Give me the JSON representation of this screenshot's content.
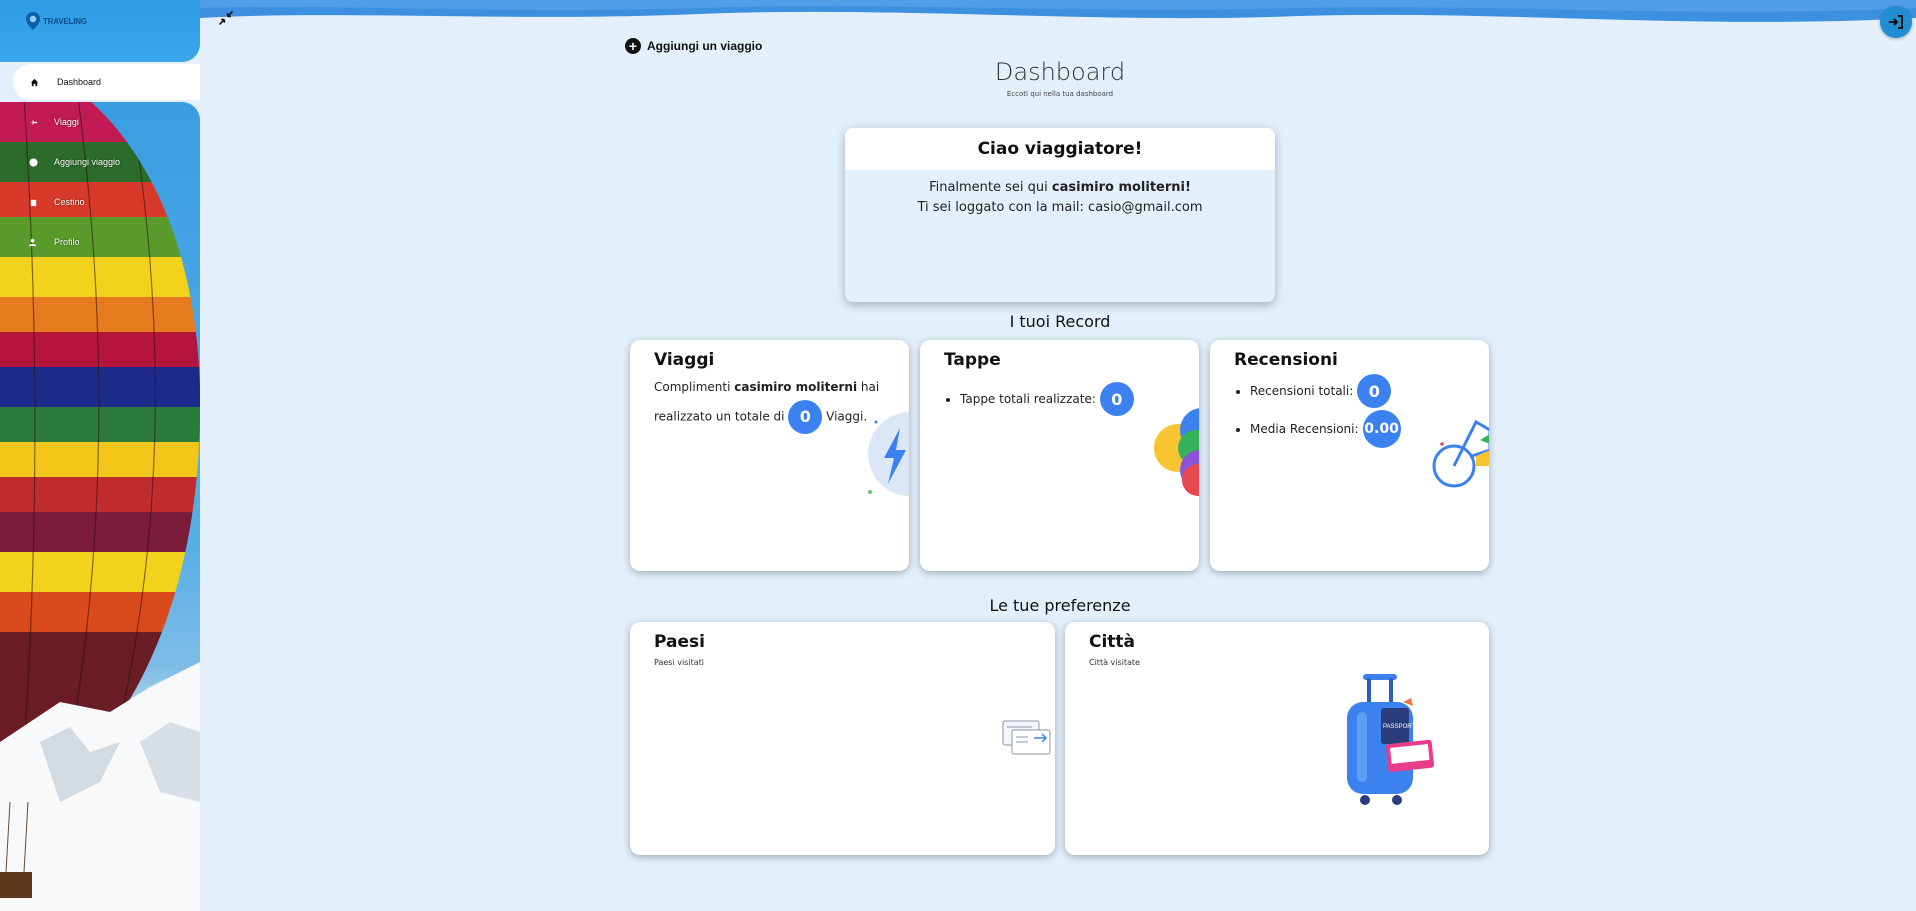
{
  "app": {
    "logo_text": "TRAVELING"
  },
  "sidebar": {
    "items": [
      {
        "label": "Dashboard",
        "icon": "home-icon"
      },
      {
        "label": "Viaggi",
        "icon": "plane-icon"
      },
      {
        "label": "Aggiungi viaggio",
        "icon": "plus-circle-icon"
      },
      {
        "label": "Cestino",
        "icon": "trash-icon"
      },
      {
        "label": "Profilo",
        "icon": "user-icon"
      }
    ]
  },
  "header": {
    "add_trip_label": "Aggiungi un viaggio",
    "title": "Dashboard",
    "subtitle": "Eccoti qui nella tua dashboard"
  },
  "welcome": {
    "title": "Ciao viaggiatore!",
    "line1_prefix": "Finalmente sei qui ",
    "user_name": "casimiro moliterni!",
    "line2": "Ti sei loggato con la mail: casio@gmail.com"
  },
  "records": {
    "section_title": "I tuoi Record",
    "viaggi": {
      "title": "Viaggi",
      "text_prefix": "Complimenti ",
      "user_name": "casimiro moliterni",
      "text_mid": " hai realizzato un totale di ",
      "count": "0",
      "text_suffix": " Viaggi."
    },
    "tappe": {
      "title": "Tappe",
      "label": "Tappe totali realizzate:",
      "count": "0"
    },
    "recensioni": {
      "title": "Recensioni",
      "total_label": "Recensioni totali:",
      "total": "0",
      "avg_label": "Media Recensioni:",
      "avg": "0.00"
    }
  },
  "preferences": {
    "section_title": "Le tue preferenze",
    "paesi": {
      "title": "Paesi",
      "subtitle": "Paesi visitati"
    },
    "citta": {
      "title": "Città",
      "subtitle": "Città visitate"
    }
  },
  "colors": {
    "accent": "#3b82f0",
    "sidebar_blue": "#2f9be5",
    "background": "#e3f0fb"
  }
}
